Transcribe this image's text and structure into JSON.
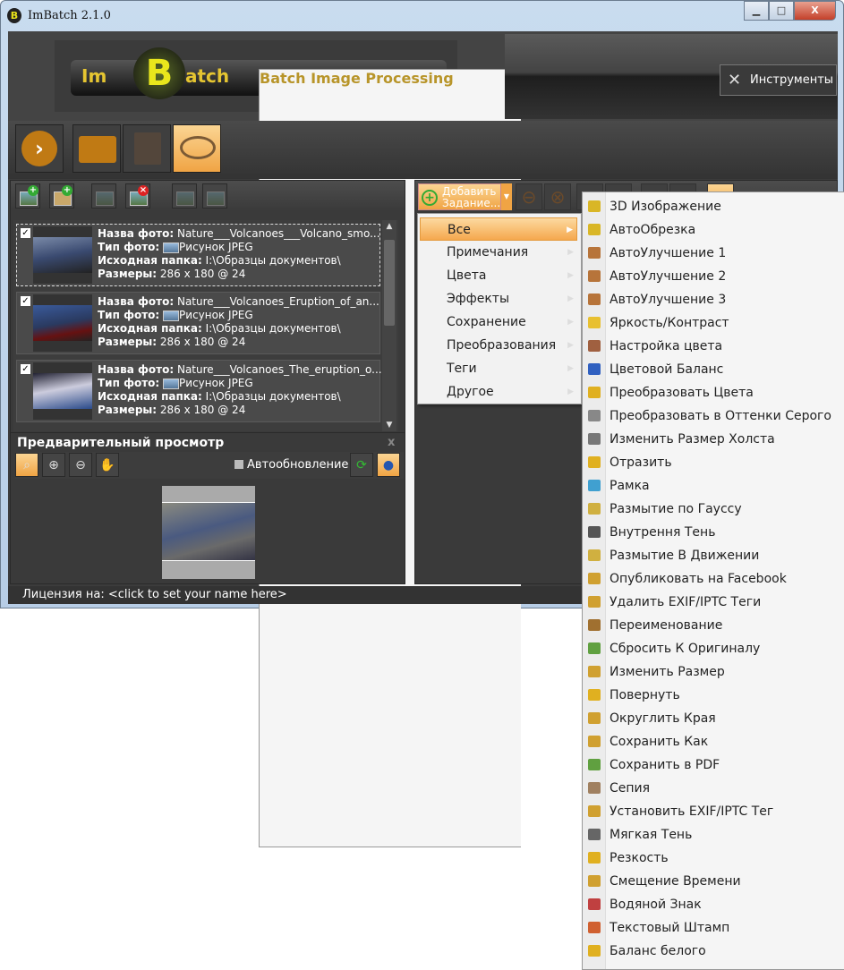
{
  "window": {
    "title": "ImBatch 2.1.0",
    "app_icon": "B",
    "minimize": "▁",
    "maximize": "□",
    "close": "X"
  },
  "logo": {
    "im": "Im",
    "b": "B",
    "atch": "atch",
    "subtitle": "Batch Image Processing"
  },
  "tools_button": "Инструменты",
  "file_list": [
    {
      "checked": true,
      "selected": true,
      "name_label": "Назва фото:",
      "name": "Nature___Volcanoes___Volcano_smo...",
      "type_label": "Тип фото:",
      "type": "Рисунок JPEG",
      "folder_label": "Исходная папка:",
      "folder": "I:\\Образцы документов\\",
      "size_label": "Размеры:",
      "size": "286 x 180 @ 24"
    },
    {
      "checked": true,
      "selected": false,
      "name_label": "Назва фото:",
      "name": "Nature___Volcanoes_Eruption_of_an...",
      "type_label": "Тип фото:",
      "type": "Рисунок JPEG",
      "folder_label": "Исходная папка:",
      "folder": "I:\\Образцы документов\\",
      "size_label": "Размеры:",
      "size": "286 x 180 @ 24"
    },
    {
      "checked": true,
      "selected": false,
      "name_label": "Назва фото:",
      "name": "Nature___Volcanoes_The_eruption_o...",
      "type_label": "Тип фото:",
      "type": "Рисунок JPEG",
      "folder_label": "Исходная папка:",
      "folder": "I:\\Образцы документов\\",
      "size_label": "Размеры:",
      "size": "286 x 180 @ 24"
    }
  ],
  "preview": {
    "title": "Предварительный просмотр",
    "close": "x",
    "auto_update": "Автообновление"
  },
  "status": "Лицензия на: <click to set your name here>",
  "add_task": {
    "line1": "Добавить",
    "line2": "Задание..."
  },
  "categories": [
    "Все",
    "Примечания",
    "Цвета",
    "Эффекты",
    "Сохранение",
    "Преобразования",
    "Теги",
    "Другое"
  ],
  "tasks": [
    {
      "label": "3D Изображение",
      "color": "#d9b626"
    },
    {
      "label": "АвтоОбрезка",
      "color": "#d9b626"
    },
    {
      "label": "АвтоУлучшение 1",
      "color": "#b7743a"
    },
    {
      "label": "АвтоУлучшение 2",
      "color": "#b7743a"
    },
    {
      "label": "АвтоУлучшение 3",
      "color": "#b7743a"
    },
    {
      "label": "Яркость/Контраст",
      "color": "#e8c030"
    },
    {
      "label": "Настройка цвета",
      "color": "#a06040"
    },
    {
      "label": "Цветовой Баланс",
      "color": "#3060c0"
    },
    {
      "label": "Преобразовать Цвета",
      "color": "#e0b020"
    },
    {
      "label": "Преобразовать в Оттенки Серого",
      "color": "#888888"
    },
    {
      "label": "Изменить Размер Холста",
      "color": "#777777"
    },
    {
      "label": "Отразить",
      "color": "#e0b020"
    },
    {
      "label": "Рамка",
      "color": "#40a0d0"
    },
    {
      "label": "Размытие по Гауссу",
      "color": "#d0b040"
    },
    {
      "label": "Внутрення Тень",
      "color": "#555555"
    },
    {
      "label": "Размытие В Движении",
      "color": "#d0b040"
    },
    {
      "label": "Опубликовать на Facebook",
      "color": "#d0a030"
    },
    {
      "label": "Удалить EXIF/IPTC Теги",
      "color": "#d0a030"
    },
    {
      "label": "Переименование",
      "color": "#a07030"
    },
    {
      "label": "Сбросить К Оригиналу",
      "color": "#60a040"
    },
    {
      "label": "Изменить Размер",
      "color": "#d0a030"
    },
    {
      "label": "Повернуть",
      "color": "#e0b020"
    },
    {
      "label": "Округлить Края",
      "color": "#d0a030"
    },
    {
      "label": "Сохранить Как",
      "color": "#d0a030"
    },
    {
      "label": "Сохранить в PDF",
      "color": "#60a040"
    },
    {
      "label": "Сепия",
      "color": "#a08060"
    },
    {
      "label": "Установить EXIF/IPTC Тег",
      "color": "#d0a030"
    },
    {
      "label": "Мягкая Тень",
      "color": "#666666"
    },
    {
      "label": "Резкость",
      "color": "#e0b020"
    },
    {
      "label": "Смещение Времени",
      "color": "#d0a030"
    },
    {
      "label": "Водяной Знак",
      "color": "#c04040"
    },
    {
      "label": "Текстовый Штамп",
      "color": "#d06030"
    },
    {
      "label": "Баланс белого",
      "color": "#e0b020"
    }
  ]
}
